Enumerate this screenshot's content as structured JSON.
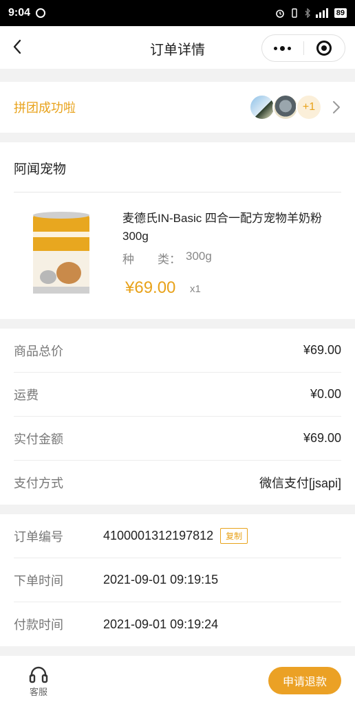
{
  "status_bar": {
    "time": "9:04",
    "battery": "89"
  },
  "nav": {
    "title": "订单详情"
  },
  "group": {
    "label": "拼团成功啦",
    "extra_count": "+1"
  },
  "store": {
    "name": "阿闻宠物",
    "product": {
      "title": "麦德氏IN-Basic 四合一配方宠物羊奶粉 300g",
      "spec_key": "种　　类：",
      "spec_value": "300g",
      "price": "¥69.00",
      "quantity": "x1"
    }
  },
  "summary": [
    {
      "key": "商品总价",
      "value": "¥69.00"
    },
    {
      "key": "运费",
      "value": "¥0.00"
    },
    {
      "key": "实付金额",
      "value": "¥69.00"
    },
    {
      "key": "支付方式",
      "value": "微信支付[jsapi]"
    }
  ],
  "order": [
    {
      "key": "订单编号",
      "value": "4100001312197812",
      "copy_label": "复制"
    },
    {
      "key": "下单时间",
      "value": "2021-09-01 09:19:15"
    },
    {
      "key": "付款时间",
      "value": "2021-09-01 09:19:24"
    }
  ],
  "bottom": {
    "service_label": "客服",
    "refund_label": "申请退款"
  },
  "colors": {
    "accent": "#e8a21a"
  }
}
